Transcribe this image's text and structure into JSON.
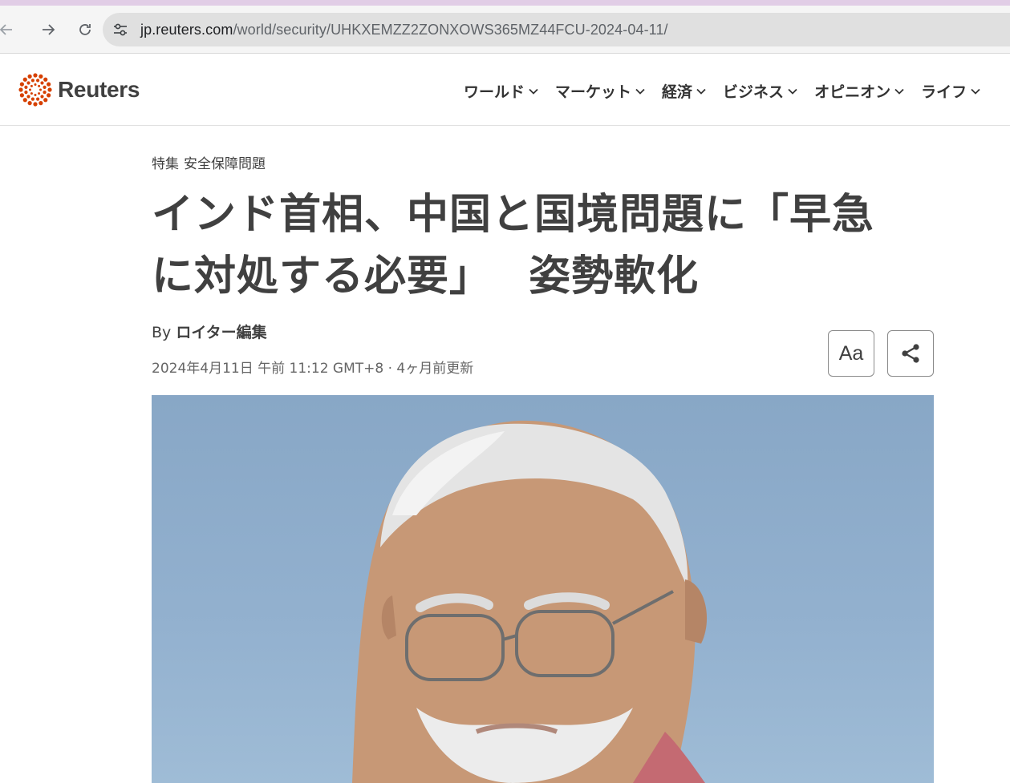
{
  "browser": {
    "url_host": "jp.reuters.com",
    "url_path": "/world/security/UHKXEMZZ2ZONXOWS365MZ44FCU-2024-04-11/",
    "icons": [
      "back-arrow-icon",
      "forward-arrow-icon",
      "reload-icon",
      "site-settings-icon"
    ]
  },
  "header": {
    "logo_text": "Reuters",
    "nav": [
      "ワールド",
      "マーケット",
      "経済",
      "ビジネス",
      "オピニオン",
      "ライフ"
    ]
  },
  "article": {
    "kicker_label": "特集",
    "kicker_topic": "安全保障問題",
    "headline_line1": "インド首相、中国と国境問題に「早急",
    "headline_line2": "に対処する必要」　 姿勢軟化",
    "byline_prefix": "By",
    "byline_author": "ロイター編集",
    "dateline": "2024年4月11日 午前 11:12 GMT+8 · 4ヶ月前更新",
    "text_size_button": "Aa"
  },
  "colors": {
    "brand_orange": "#d64000",
    "text": "#404040",
    "photo_sky": "#8faccb"
  }
}
